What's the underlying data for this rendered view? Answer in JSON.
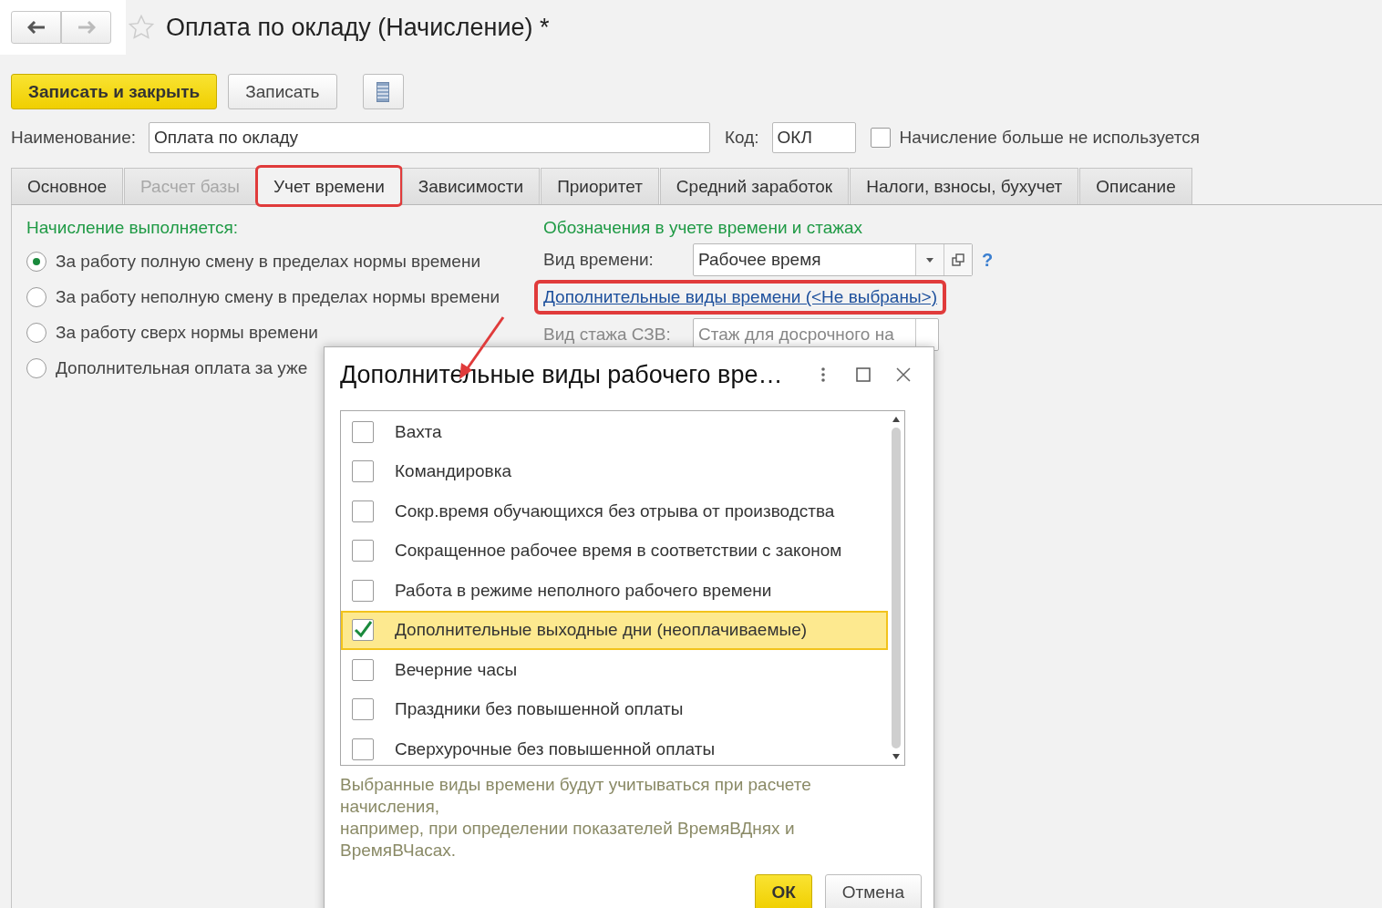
{
  "window": {
    "title": "Оплата по окладу (Начисление) *",
    "favorite": false
  },
  "toolbar": {
    "buttons": [
      {
        "label": "Записать и закрыть",
        "kind": "primary"
      },
      {
        "label": "Записать",
        "kind": "normal"
      },
      {
        "kind": "icon"
      }
    ]
  },
  "name_field": {
    "label": "Наименование:",
    "value": "Оплата по окладу"
  },
  "code_field": {
    "label": "Код:",
    "value": "ОКЛ"
  },
  "unused_checkbox": {
    "label": "Начисление больше не используется",
    "checked": false
  },
  "tabs": [
    {
      "label": "Основное",
      "selected": false,
      "disabled": false,
      "highlighted": false
    },
    {
      "label": "Расчет базы",
      "selected": false,
      "disabled": true,
      "highlighted": false
    },
    {
      "label": "Учет времени",
      "selected": true,
      "disabled": false,
      "highlighted": true
    },
    {
      "label": "Зависимости",
      "selected": false,
      "disabled": false,
      "highlighted": false
    },
    {
      "label": "Приоритет",
      "selected": false,
      "disabled": false,
      "highlighted": false
    },
    {
      "label": "Средний заработок",
      "selected": false,
      "disabled": false,
      "highlighted": false
    },
    {
      "label": "Налоги, взносы, бухучет",
      "selected": false,
      "disabled": false,
      "highlighted": false
    },
    {
      "label": "Описание",
      "selected": false,
      "disabled": false,
      "highlighted": false
    }
  ],
  "accrual": {
    "heading": "Начисление выполняется:",
    "options": [
      {
        "label": "За работу полную смену в пределах нормы времени",
        "selected": true
      },
      {
        "label": "За работу неполную смену в пределах нормы времени",
        "selected": false
      },
      {
        "label": "За работу сверх нормы времени",
        "selected": false
      },
      {
        "label": "Дополнительная оплата за уже",
        "selected": false
      }
    ]
  },
  "designations": {
    "heading": "Обозначения в учете времени и стажах",
    "time_kind": {
      "label": "Вид времени:",
      "value": "Рабочее время"
    },
    "help": "?",
    "link": {
      "text": "Дополнительные виды времени (<Не выбраны>)",
      "highlighted": true
    },
    "seniority": {
      "label": "Вид стажа СЗВ:",
      "value": "Стаж для досрочного на"
    }
  },
  "dialog": {
    "title": "Дополнительные виды рабочего вре…",
    "items": [
      {
        "label": "Вахта",
        "checked": false,
        "selected": false
      },
      {
        "label": "Командировка",
        "checked": false,
        "selected": false
      },
      {
        "label": "Сокр.время обучающихся без отрыва от производства",
        "checked": false,
        "selected": false
      },
      {
        "label": "Сокращенное рабочее время в соответствии с законом",
        "checked": false,
        "selected": false
      },
      {
        "label": "Работа в режиме неполного рабочего времени",
        "checked": false,
        "selected": false
      },
      {
        "label": "Дополнительные выходные дни (неоплачиваемые)",
        "checked": true,
        "selected": true
      },
      {
        "label": "Вечерние часы",
        "checked": false,
        "selected": false
      },
      {
        "label": "Праздники без повышенной оплаты",
        "checked": false,
        "selected": false
      },
      {
        "label": "Сверхурочные без повышенной оплаты",
        "checked": false,
        "selected": false
      }
    ],
    "note": "Выбранные виды времени будут учитываться при расчете\nначисления,\nнапример, при определении показателей ВремяВДнях и\nВремяВЧасах.",
    "buttons": [
      {
        "label": "ОК",
        "kind": "primary"
      },
      {
        "label": "Отмена",
        "kind": "normal"
      }
    ]
  }
}
